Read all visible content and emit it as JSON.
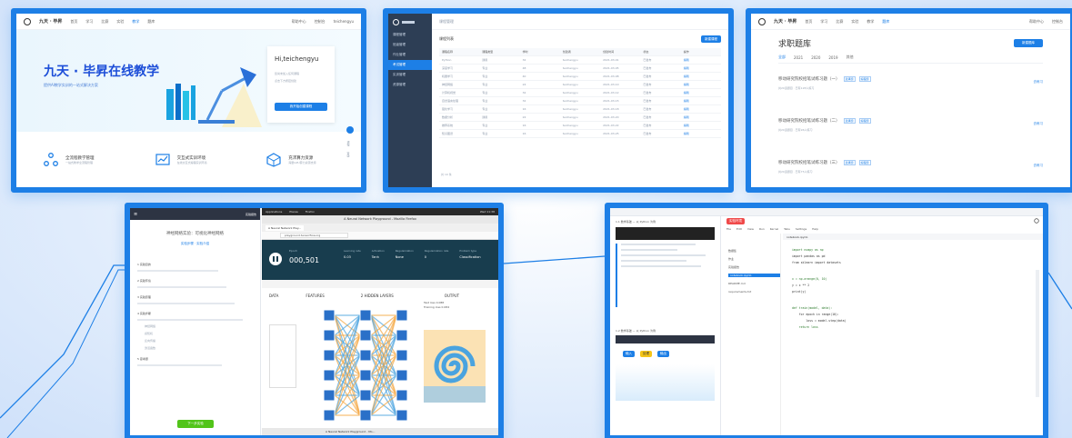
{
  "colors": {
    "accent": "#1d7fe6",
    "dark_sidebar": "#2d3e55",
    "green": "#52c41a",
    "red": "#f04a4a"
  },
  "portal": {
    "brand": "九天 · 毕昇",
    "nav": [
      "首页",
      "学习",
      "比赛",
      "实验",
      "教学",
      "题库"
    ],
    "nav_active_index": 4,
    "top_right": [
      "帮助中心",
      "控制台",
      "teichengyu"
    ],
    "hero_title": "九天 · 毕昇在线教学",
    "hero_subtitle": "提供AI教学实训的一站式解决方案",
    "greeting": "Hi,teichengyu",
    "greet_line1": "您尚未加入任何课程",
    "greet_line2": "点击下方按钮创建",
    "greet_button": "我开始创建课程",
    "features": [
      {
        "icon": "share-nodes-icon",
        "title": "全流程教学管理",
        "desc": "一站式教学全流程管理"
      },
      {
        "icon": "chart-line-icon",
        "title": "交互式实训环境",
        "desc": "在线交互式编程实训环境"
      },
      {
        "icon": "cube-icon",
        "title": "充沛算力资源",
        "desc": "海量GPU算力资源支持"
      }
    ],
    "side_labels": [
      "课程",
      "答疑"
    ]
  },
  "admin": {
    "sidebar": [
      "课程管理",
      "班级管理",
      "作业管理",
      "考试管理",
      "实训管理",
      "资源管理"
    ],
    "sidebar_active_index": 3,
    "breadcrumb": "课程管理",
    "section_title": "课程列表",
    "action_button": "新建课程",
    "columns": [
      "课程名称",
      "课程类型",
      "学时",
      "创建者",
      "创建时间",
      "状态",
      "操作"
    ],
    "rows": [
      [
        "Python",
        "通用",
        "32",
        "teichengyu",
        "2021-03-01",
        "已发布",
        "编辑"
      ],
      [
        "深度学习",
        "专业",
        "48",
        "teichengyu",
        "2021-03-05",
        "已发布",
        "编辑"
      ],
      [
        "机器学习",
        "专业",
        "40",
        "teichengyu",
        "2021-03-08",
        "已发布",
        "编辑"
      ],
      [
        "神经网络",
        "专业",
        "24",
        "teichengyu",
        "2021-03-10",
        "已发布",
        "编辑"
      ],
      [
        "计算机视觉",
        "专业",
        "32",
        "teichengyu",
        "2021-03-12",
        "已发布",
        "编辑"
      ],
      [
        "自然语言处理",
        "专业",
        "32",
        "teichengyu",
        "2021-03-15",
        "已发布",
        "编辑"
      ],
      [
        "强化学习",
        "专业",
        "16",
        "teichengyu",
        "2021-03-18",
        "已发布",
        "编辑"
      ],
      [
        "数据分析",
        "通用",
        "24",
        "teichengyu",
        "2021-03-20",
        "已发布",
        "编辑"
      ],
      [
        "推荐系统",
        "专业",
        "16",
        "teichengyu",
        "2021-03-22",
        "已发布",
        "编辑"
      ],
      [
        "知识图谱",
        "专业",
        "16",
        "teichengyu",
        "2021-03-25",
        "已发布",
        "编辑"
      ]
    ],
    "pagination": "共 10 条"
  },
  "question_bank": {
    "title": "求职题库",
    "add_button": "新建题库",
    "tabs": [
      "全部",
      "2021",
      "2020",
      "2019",
      "其他"
    ],
    "tabs_active_index": 0,
    "items": [
      {
        "title": "移动研究院校招笔试练习题（一）",
        "tags": [
          "选择题",
          "编程题"
        ],
        "meta": "共20道题目 · 已有128人练习",
        "action": "去练习"
      },
      {
        "title": "移动研究院校招笔试练习题（二）",
        "tags": [
          "选择题",
          "编程题"
        ],
        "meta": "共20道题目 · 已有96人练习",
        "action": "去练习"
      },
      {
        "title": "移动研究院校招笔试练习题（三）",
        "tags": [
          "选择题",
          "编程题"
        ],
        "meta": "共20道题目 · 已有75人练习",
        "action": "去练习"
      }
    ]
  },
  "lab": {
    "toolbar_left": "≡",
    "toolbar_right": [
      "实验报告",
      "工具栏"
    ],
    "doc_title": "神经网络实验：可视化神经网络",
    "doc_subtitle": "实验步骤 · 实验介绍",
    "sections": [
      "1 实验目的",
      "2 实验环境",
      "3 实验原理",
      "4 实验步骤",
      "5 思考题"
    ],
    "bullets": [
      "神经网络",
      "感知机",
      "反向传播",
      "激活函数"
    ],
    "next_button": "下一步实验",
    "desktop_menu": [
      "Applications",
      "Places",
      "Firefox"
    ],
    "clock": "Wed 11:38",
    "window_title": "A Neural Network Playground - Mozilla Firefox",
    "tab_title": "A Neural Network Play...",
    "url": "playground.tensorflow.org",
    "epoch_label": "Epoch",
    "epoch_value": "000,501",
    "params": [
      {
        "label": "Learning rate",
        "value": "0.03"
      },
      {
        "label": "Activation",
        "value": "Tanh"
      },
      {
        "label": "Regularization",
        "value": "None"
      },
      {
        "label": "Regularization rate",
        "value": "0"
      },
      {
        "label": "Problem type",
        "value": "Classification"
      }
    ],
    "columns": [
      "DATA",
      "FEATURES",
      "2 HIDDEN LAYERS",
      "OUTPUT"
    ],
    "test_loss": "Test loss 0.088",
    "train_loss": "Training loss 0.084",
    "taskbar_item": "A Neural Network Playground - Mo..."
  },
  "notebook": {
    "left_header_1": "1.1 数学基础 — 以 Python 为例",
    "left_header_2": "1.2 数学基础 — 以 Python 为例",
    "mode_label": "实验环境",
    "tabs": [
      "File",
      "Edit",
      "View",
      "Run",
      "Kernel",
      "Tabs",
      "Settings",
      "Help"
    ],
    "file_tab": "notebook.ipynb",
    "files": [
      "数据集",
      "作业",
      "实验报告",
      "notebook.ipynb",
      "README.md",
      "requirements.txt"
    ],
    "code_lines": [
      "import numpy as np",
      "import pandas as pd",
      "from sklearn import datasets",
      "x = np.arange(0, 10)",
      "y = x ** 2",
      "print(y)",
      "def train(model, data):",
      "    for epoch in range(10):",
      "        loss = model.step(data)",
      "    return loss"
    ],
    "flow_labels": [
      "输入",
      "处理",
      "输出"
    ]
  }
}
